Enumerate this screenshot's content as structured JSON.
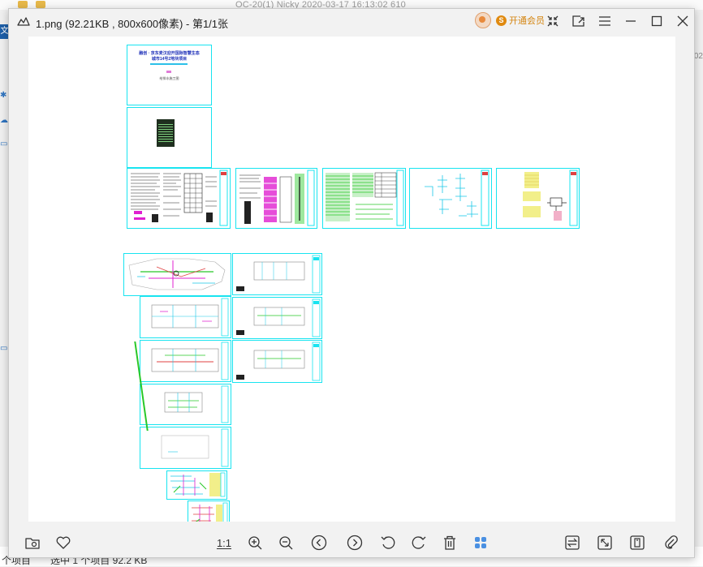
{
  "background": {
    "title_text": "OC-20(1)  Nicky  2020-03-17 16:13:02  610",
    "left_tab": "文",
    "right_text": "02",
    "status_left": "个项目",
    "status_right": "选中 1 个项目  92.2 KB"
  },
  "window": {
    "title": "1.png (92.21KB , 800x600像素) - 第1/1张",
    "vip_label": "开通会员",
    "vip_badge": "S"
  },
  "toolbar": {
    "actual_size_label": "1:1"
  },
  "colors": {
    "sheet_border": "#18e4f0",
    "accent_blue": "#4a90e2",
    "cad_magenta": "#e020d0",
    "cad_green": "#28c828"
  },
  "cover_sheet": {
    "title_line1": "融创 · 京东麦汉迎开国际智慧生态",
    "title_line2": "城市14号2地块项目",
    "subtitle": "给排水施工图"
  }
}
